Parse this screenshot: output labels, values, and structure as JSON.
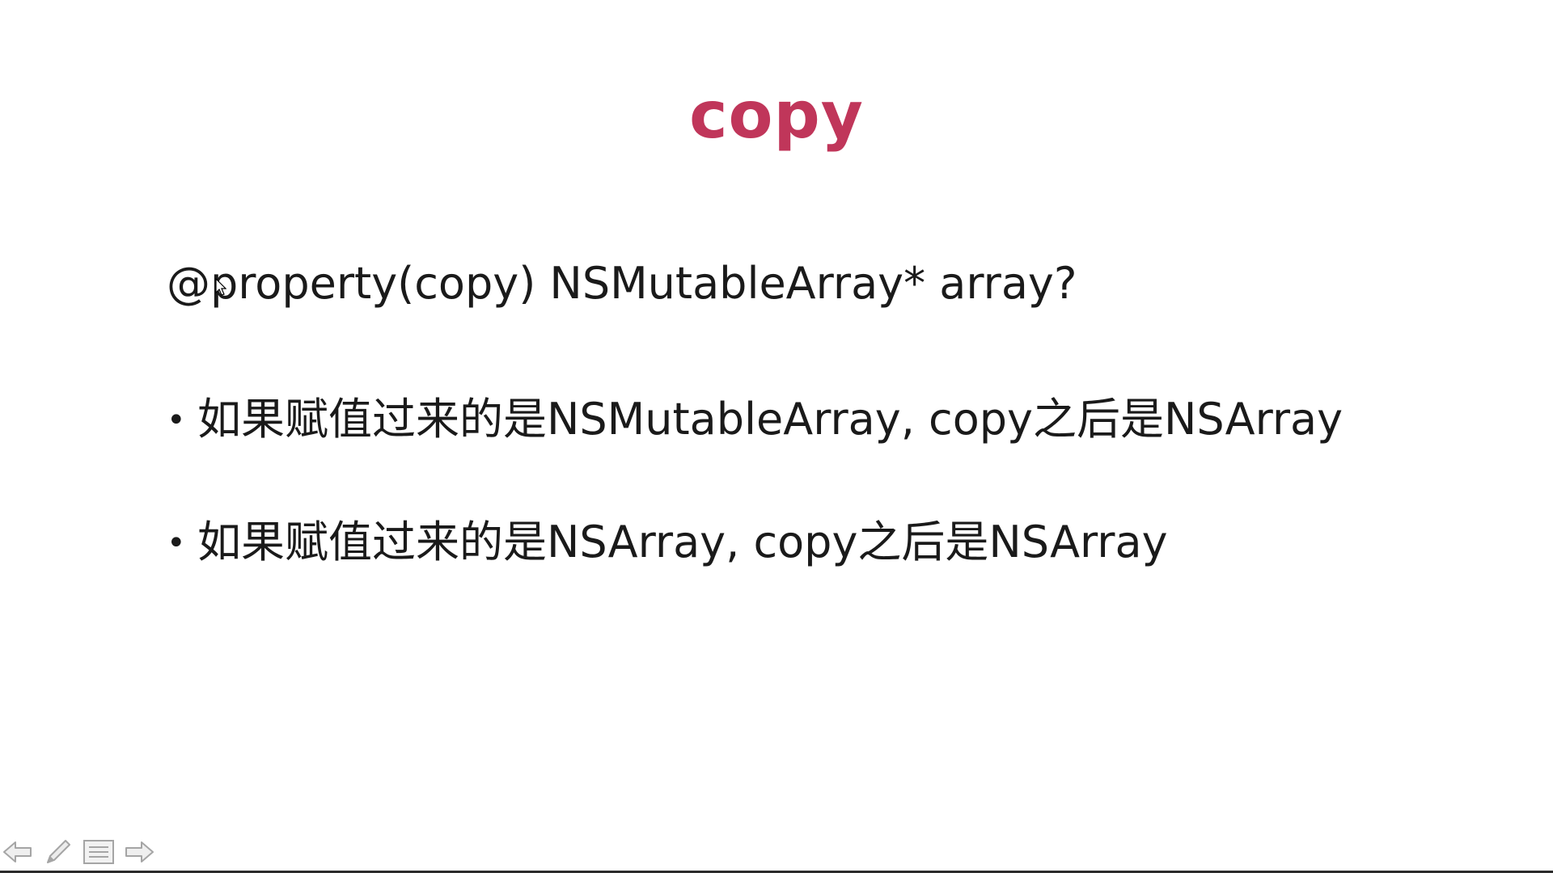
{
  "slide": {
    "title": "copy",
    "property_line": "@property(copy) NSMutableArray* array?",
    "bullets": [
      {
        "dot": "•",
        "text": "如果赋值过来的是NSMutableArray, copy之后是NSArray"
      },
      {
        "dot": "•",
        "text": "如果赋值过来的是NSArray, copy之后是NSArray"
      }
    ]
  },
  "toolbar": {
    "icons": [
      "previous-slide-icon",
      "pen-icon",
      "slide-menu-icon",
      "next-slide-icon"
    ]
  },
  "colors": {
    "title": "#c0365a",
    "text": "#1a1a1a",
    "background": "#ffffff",
    "toolbar_icon": "#a0a0a0"
  }
}
